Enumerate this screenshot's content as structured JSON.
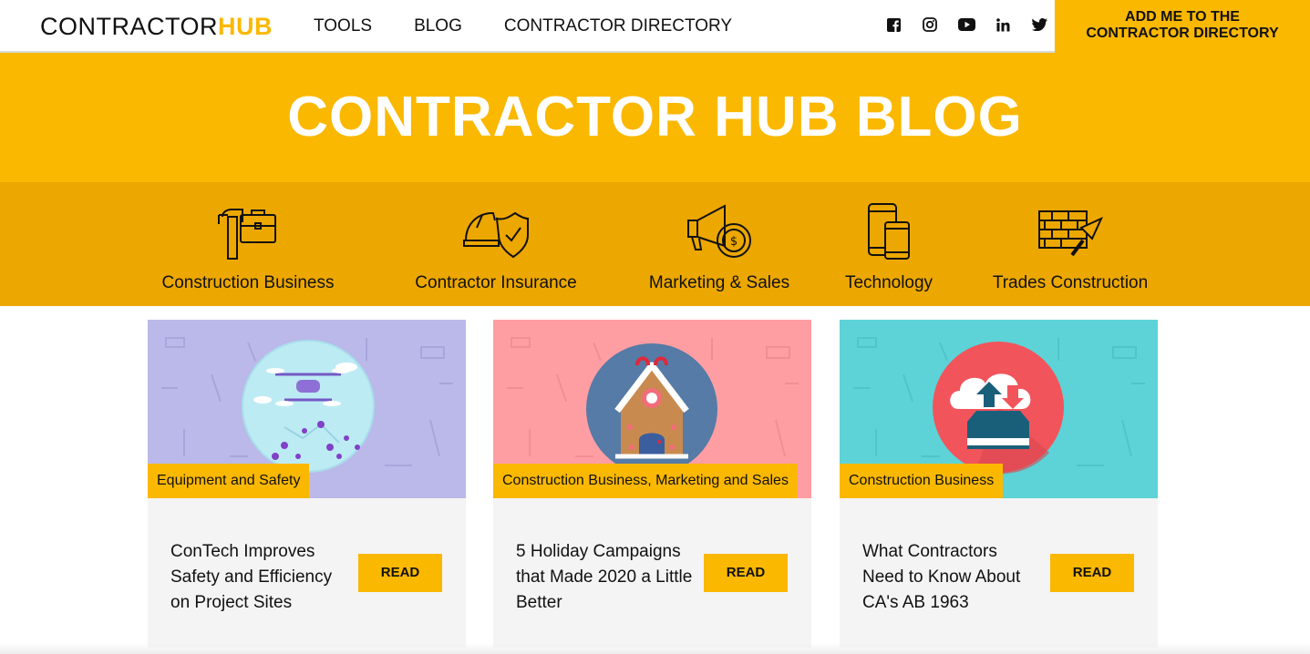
{
  "logo": {
    "part1": "CONTRACTOR",
    "part2": "HUB"
  },
  "nav": {
    "items": [
      "TOOLS",
      "BLOG",
      "CONTRACTOR DIRECTORY"
    ]
  },
  "social": [
    "facebook-icon",
    "instagram-icon",
    "youtube-icon",
    "linkedin-icon",
    "twitter-icon"
  ],
  "cta": {
    "line1": "ADD ME TO THE",
    "line2": "CONTRACTOR DIRECTORY"
  },
  "hero": {
    "title": "CONTRACTOR HUB BLOG"
  },
  "categories": [
    {
      "label": "Construction Business",
      "icon": "mailbox-briefcase-icon"
    },
    {
      "label": "Contractor Insurance",
      "icon": "hardhat-shield-icon"
    },
    {
      "label": "Marketing & Sales",
      "icon": "megaphone-coin-icon"
    },
    {
      "label": "Technology",
      "icon": "devices-icon"
    },
    {
      "label": "Trades Construction",
      "icon": "bricks-trowel-icon"
    }
  ],
  "cards": [
    {
      "tag": "Equipment and Safety",
      "title": "ConTech Improves Safety and Efficiency on Project Sites",
      "read": "READ",
      "image": "drone-illustration"
    },
    {
      "tag": "Construction Business, Marketing and Sales",
      "title": "5 Holiday Campaigns that Made 2020 a Little Better",
      "read": "READ",
      "image": "gingerbread-house-illustration"
    },
    {
      "tag": "Construction Business",
      "title": "What Contractors Need to Know About CA's AB 1963",
      "read": "READ",
      "image": "cloud-upload-illustration"
    }
  ],
  "colors": {
    "brand_yellow": "#FBB800",
    "category_band": "#ECA700",
    "card1_bg": "#BAB9E9",
    "card2_bg": "#FE9EA3",
    "card3_bg": "#5DD3D7"
  }
}
